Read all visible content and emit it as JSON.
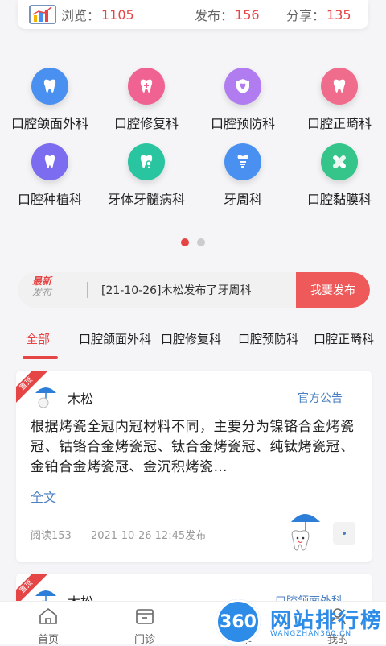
{
  "stats": {
    "views_label": "浏览：",
    "views_value": "1105",
    "posts_label": "发布：",
    "posts_value": "156",
    "shares_label": "分享：",
    "shares_value": "135",
    "icon": "bar-chart-icon"
  },
  "categories": [
    {
      "label": "口腔颌面外科",
      "icon": "tooth-icon",
      "color": "#4a90f0"
    },
    {
      "label": "口腔修复科",
      "icon": "tooth-repair-icon",
      "color": "#f06292"
    },
    {
      "label": "口腔预防科",
      "icon": "tooth-shield-icon",
      "color": "#b07cf0"
    },
    {
      "label": "口腔正畸科",
      "icon": "tooth-brace-icon",
      "color": "#f06c8c"
    },
    {
      "label": "口腔种植科",
      "icon": "tooth-implant-icon",
      "color": "#7b6cf0"
    },
    {
      "label": "牙体牙髓病科",
      "icon": "tooth-search-icon",
      "color": "#29c4a0"
    },
    {
      "label": "牙周科",
      "icon": "tooth-root-icon",
      "color": "#4a90f0"
    },
    {
      "label": "口腔黏膜科",
      "icon": "bandage-icon",
      "color": "#35c48a"
    }
  ],
  "pager": {
    "count": 2,
    "active": 0
  },
  "news": {
    "tag_top": "最新",
    "tag_bottom": "发布",
    "text": "[21-10-26]木松发布了牙周科",
    "button": "我要发布"
  },
  "tabs": [
    "全部",
    "口腔颌面外科",
    "口腔修复科",
    "口腔预防科",
    "口腔正畸科"
  ],
  "posts": [
    {
      "ribbon": "置顶",
      "author": "木松",
      "category": "官方公告",
      "content": "根据烤瓷全冠内冠材料不同，主要分为镍铬合金烤瓷冠、钴铬合金烤瓷冠、钛合金烤瓷冠、纯钛烤瓷冠、金铂合金烤瓷冠、金沉积烤瓷…",
      "more": "全文",
      "reads": "阅读153",
      "time": "2021-10-26 12:45发布"
    },
    {
      "ribbon": "置顶",
      "author": "木松",
      "category": "口腔颌面外科"
    }
  ],
  "bottom_nav": [
    {
      "label": "首页",
      "icon": "home-icon"
    },
    {
      "label": "门诊",
      "icon": "clinic-icon"
    },
    {
      "label": "订单",
      "icon": "order-icon"
    },
    {
      "label": "我的",
      "icon": "profile-icon"
    }
  ],
  "watermark": {
    "badge": "360",
    "title": "网站排行榜",
    "subtitle": "WANGZHAN360.CN"
  }
}
